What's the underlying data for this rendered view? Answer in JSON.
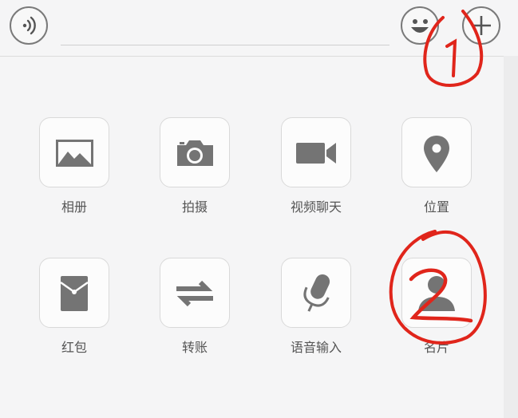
{
  "toolbar": {
    "voice_icon": "voice-wave-icon",
    "emoji_icon": "emoji-face-icon",
    "plus_icon": "plus-icon"
  },
  "panel": {
    "items": [
      {
        "label": "相册",
        "icon": "photo-album-icon"
      },
      {
        "label": "拍摄",
        "icon": "camera-icon"
      },
      {
        "label": "视频聊天",
        "icon": "video-camera-icon"
      },
      {
        "label": "位置",
        "icon": "location-pin-icon"
      },
      {
        "label": "红包",
        "icon": "red-envelope-icon"
      },
      {
        "label": "转账",
        "icon": "transfer-arrows-icon"
      },
      {
        "label": "语音输入",
        "icon": "microphone-icon"
      },
      {
        "label": "名片",
        "icon": "contact-card-icon"
      }
    ]
  },
  "annotations": {
    "mark1_text": "1",
    "mark2_text": "2",
    "color": "#e0251b"
  },
  "colors": {
    "icon_gray": "#747474",
    "background": "#f5f5f6"
  }
}
